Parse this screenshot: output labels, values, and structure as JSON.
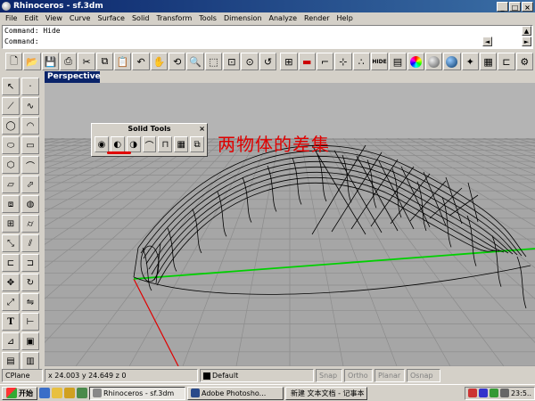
{
  "window": {
    "title": "Rhinoceros - sf.3dm",
    "min": "_",
    "max": "□",
    "close": "×"
  },
  "menu": [
    "File",
    "Edit",
    "View",
    "Curve",
    "Surface",
    "Solid",
    "Transform",
    "Tools",
    "Dimension",
    "Analyze",
    "Render",
    "Help"
  ],
  "command": {
    "history": "Command: Hide",
    "prompt": "Command:"
  },
  "viewport": {
    "title": "Perspective"
  },
  "solid_tools": {
    "title": "Solid Tools",
    "close": "×"
  },
  "annotation": "两物体的差集",
  "statusbar": {
    "cplane": "CPlane",
    "coords": "x 24.003  y 24.649  z 0",
    "layer": "Default",
    "snap": "Snap",
    "ortho": "Ortho",
    "planar": "Planar",
    "osnap": "Osnap"
  },
  "taskbar": {
    "start": "开始",
    "tasks": [
      "Rhinoceros - sf.3dm",
      "Adobe Photosho...",
      "新建 文本文档 - 记事本"
    ],
    "clock": "23:5.."
  },
  "colors": {
    "title_bar": "#0a246a",
    "viewport_bg": "#a6a6a6",
    "x_axis": "#e00000",
    "y_axis": "#00d000",
    "annotation": "#e00000"
  }
}
